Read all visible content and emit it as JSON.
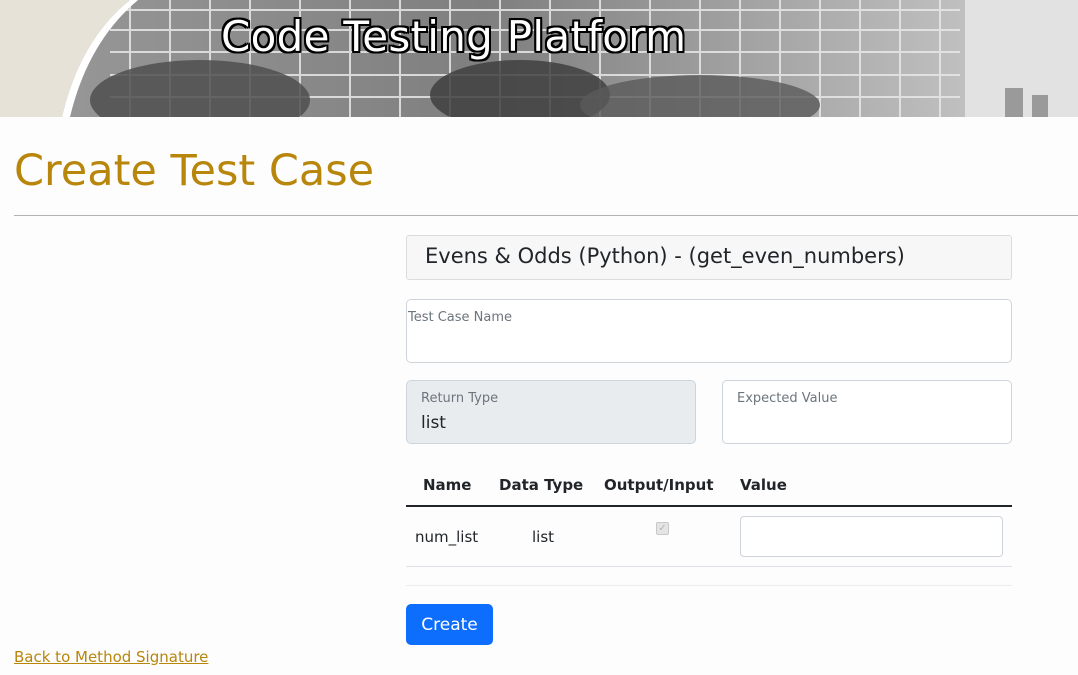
{
  "header": {
    "title": "Code Testing Platform"
  },
  "page": {
    "title": "Create Test Case"
  },
  "method": {
    "heading": "Evens & Odds (Python) - (get_even_numbers)"
  },
  "form": {
    "test_case_name": {
      "label": "Test Case Name",
      "value": ""
    },
    "return_type": {
      "label": "Return Type",
      "value": "list"
    },
    "expected_value": {
      "label": "Expected Value",
      "value": ""
    }
  },
  "params_table": {
    "headers": [
      "Name",
      "Data Type",
      "Output/Input",
      "Value"
    ],
    "rows": [
      {
        "name": "num_list",
        "data_type": "list",
        "output_input_checked": true,
        "value": ""
      }
    ]
  },
  "actions": {
    "create_label": "Create"
  },
  "links": {
    "back_label": "Back to Method Signature"
  },
  "colors": {
    "accent": "#b8860b",
    "primary": "#0d6efd"
  }
}
